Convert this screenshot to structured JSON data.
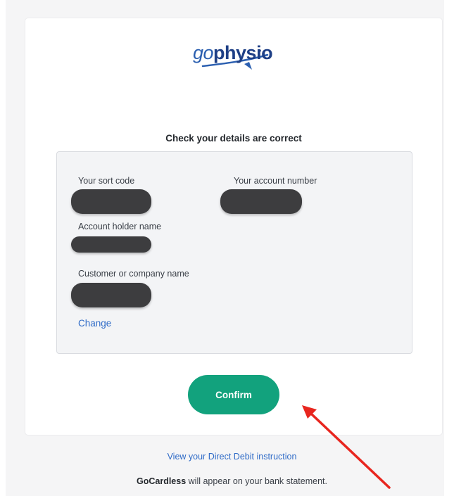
{
  "brand": {
    "logo_prefix": "go",
    "logo_suffix": "physio"
  },
  "heading": "Check your details are correct",
  "details": {
    "sort_code_label": "Your sort code",
    "account_number_label": "Your account number",
    "account_holder_label": "Account holder name",
    "customer_label": "Customer or company name",
    "change_label": "Change"
  },
  "confirm_label": "Confirm",
  "footer": {
    "direct_debit_link": "View your Direct Debit instruction",
    "statement_brand": "GoCardless",
    "statement_text": " will appear on your bank statement."
  },
  "colors": {
    "accent_green": "#12a27d",
    "link_blue": "#2f6bc7",
    "annotation_red": "#e8261f"
  }
}
